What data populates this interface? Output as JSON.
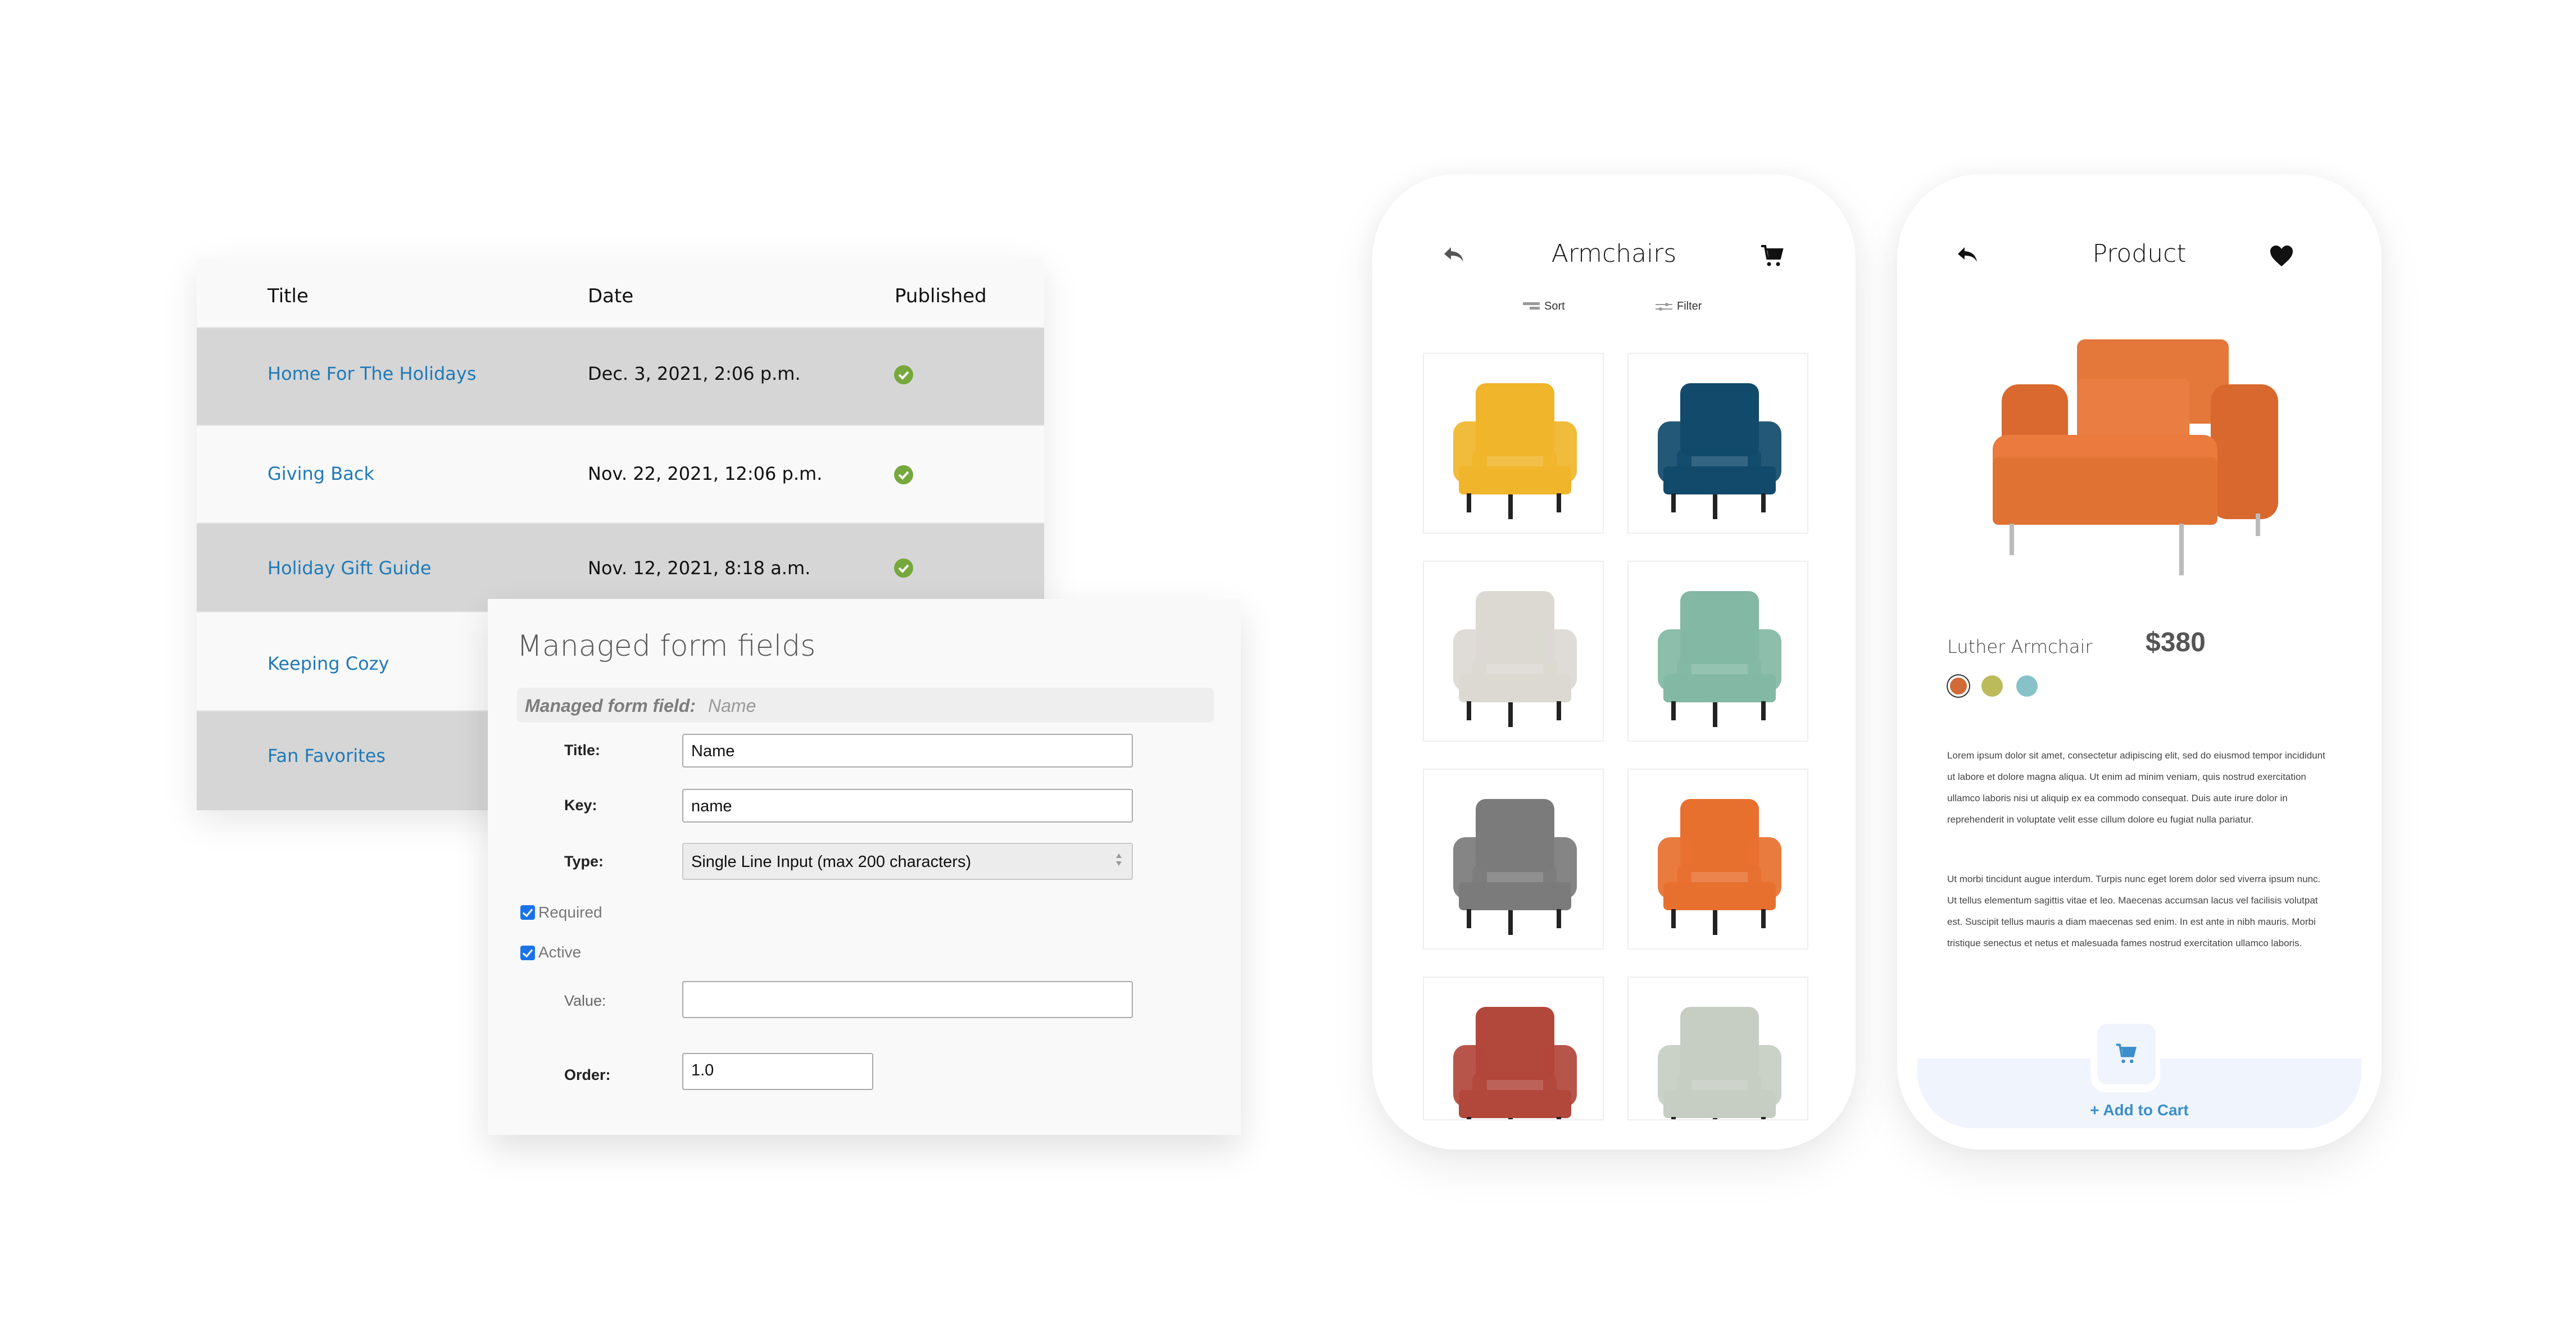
{
  "blog_table": {
    "columns": [
      "Title",
      "Date",
      "Published"
    ],
    "rows": [
      {
        "title": "Home For The Holidays",
        "date": "Dec. 3, 2021, 2:06 p.m.",
        "published": true
      },
      {
        "title": "Giving Back",
        "date": "Nov. 22, 2021, 12:06 p.m.",
        "published": true
      },
      {
        "title": "Holiday Gift Guide",
        "date": "Nov. 12, 2021, 8:18 a.m.",
        "published": true
      },
      {
        "title": "Keeping Cozy",
        "date": "",
        "published": null
      },
      {
        "title": "Fan Favorites",
        "date": "",
        "published": null
      }
    ],
    "published_icon": "check-circle-icon",
    "colors": {
      "link": "#1f7ab8",
      "check": "#76a83d",
      "row_alt": "#d6d6d6"
    }
  },
  "form": {
    "heading": "Managed form fields",
    "object_label": "Managed form field:",
    "object_name": "Name",
    "fields": {
      "title": {
        "label": "Title:",
        "value": "Name"
      },
      "key": {
        "label": "Key:",
        "value": "name"
      },
      "type": {
        "label": "Type:",
        "selected": "Single Line Input (max 200 characters)"
      },
      "required": {
        "label": "Required",
        "checked": true
      },
      "active": {
        "label": "Active",
        "checked": true
      },
      "value": {
        "label": "Value:",
        "value": ""
      },
      "order": {
        "label": "Order:",
        "value": "1.0"
      }
    }
  },
  "catalog_phone": {
    "title": "Armchairs",
    "back_icon": "reply-arrow-icon",
    "cart_icon": "cart-icon",
    "sort_label": "Sort",
    "filter_label": "Filter",
    "products": [
      {
        "name": "yellow wingback armchair",
        "color": "#f0b52a"
      },
      {
        "name": "navy velvet armchair",
        "color": "#114a6b"
      },
      {
        "name": "beige armchair with black legs",
        "color": "#dcd8d2"
      },
      {
        "name": "mint green armchair",
        "color": "#82b8a4"
      },
      {
        "name": "gray rolled-arm armchair",
        "color": "#7b7b7b"
      },
      {
        "name": "orange armchair",
        "color": "#e8702f"
      },
      {
        "name": "red armchair",
        "color": "#b2473b"
      },
      {
        "name": "sage tufted armchair",
        "color": "#c6cdc2"
      }
    ]
  },
  "product_phone": {
    "title": "Product",
    "back_icon": "reply-arrow-icon",
    "favorite_icon": "heart-icon",
    "product_name": "Luther Armchair",
    "price": "$380",
    "swatches": [
      {
        "color": "#d06a37",
        "selected": true
      },
      {
        "color": "#bcbb5c",
        "selected": false
      },
      {
        "color": "#87c2c9",
        "selected": false
      }
    ],
    "description": [
      "Lorem ipsum dolor sit amet, consectetur adipiscing elit, sed do eiusmod tempor incididunt ut labore et dolore magna aliqua. Ut enim ad minim veniam, quis nostrud exercitation ullamco laboris nisi ut aliquip ex ea commodo consequat. Duis aute irure dolor in reprehenderit in voluptate velit esse cillum dolore eu fugiat nulla pariatur.",
      "Ut morbi tincidunt augue interdum. Turpis nunc eget lorem dolor sed viverra ipsum nunc. Ut tellus elementum sagittis vitae et leo. Maecenas accumsan lacus vel facilisis volutpat est. Suscipit tellus mauris a diam maecenas sed enim. In est ante in nibh mauris. Morbi tristique senectus et netus et malesuada fames nostrud exercitation ullamco laboris."
    ],
    "add_to_cart_label": "+ Add to Cart",
    "accent": "#3a8fcc"
  }
}
